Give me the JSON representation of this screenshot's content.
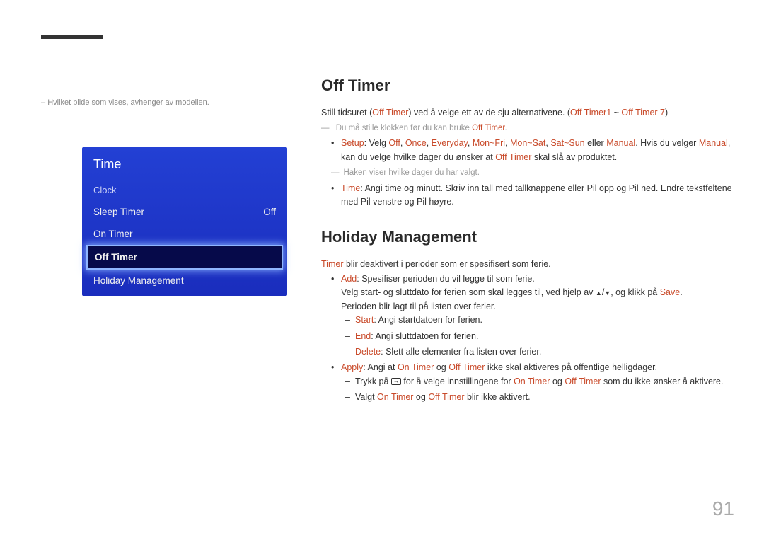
{
  "page_number": "91",
  "sidebar": {
    "title": "Time",
    "items": [
      {
        "label": "Clock",
        "value": ""
      },
      {
        "label": "Sleep Timer",
        "value": "Off"
      },
      {
        "label": "On Timer",
        "value": ""
      },
      {
        "label": "Off Timer",
        "value": ""
      },
      {
        "label": "Holiday Management",
        "value": ""
      }
    ],
    "caption_dash": "–",
    "caption": "Hvilket bilde som vises, avhenger av modellen."
  },
  "sections": {
    "off_timer": {
      "heading": "Off Timer",
      "intro_prefix": "Still tidsuret (",
      "intro_red1": "Off Timer",
      "intro_mid1": ") ved å velge ett av de sju alternativene. (",
      "intro_red2": "Off Timer1",
      "intro_tilde": " ~ ",
      "intro_red3": "Off Timer 7",
      "intro_suffix": ")",
      "note1_a": "Du må stille klokken før du kan bruke ",
      "note1_b": "Off Timer",
      "note1_c": ".",
      "setup_label": "Setup",
      "setup_a": ": Velg ",
      "setup_off": "Off",
      "setup_c1": ", ",
      "setup_once": "Once",
      "setup_c2": ", ",
      "setup_everyday": "Everyday",
      "setup_c3": ", ",
      "setup_monfri": "Mon~Fri",
      "setup_c4": ", ",
      "setup_monsat": "Mon~Sat",
      "setup_c5": ", ",
      "setup_satsun": "Sat~Sun",
      "setup_eller": " eller ",
      "setup_manual": "Manual",
      "setup_b": ". Hvis du velger ",
      "setup_manual2": "Manual",
      "setup_c": ", kan du velge hvilke dager du ønsker at ",
      "setup_offtimer": "Off Timer",
      "setup_d": " skal slå av produktet.",
      "note2": "Haken viser hvilke dager du har valgt.",
      "time_label": "Time",
      "time_text": ": Angi time og minutt. Skriv inn tall med tallknappene eller Pil opp og Pil ned. Endre tekstfeltene med Pil venstre og Pil høyre."
    },
    "holiday": {
      "heading": "Holiday Management",
      "intro_red": "Timer",
      "intro_rest": " blir deaktivert i perioder som er spesifisert som ferie.",
      "add_label": "Add",
      "add_text": ": Spesifiser perioden du vil legge til som ferie.",
      "add_line2a": "Velg start- og sluttdato for ferien som skal legges til, ved hjelp av ",
      "add_line2b": ", og klikk på ",
      "add_save": "Save",
      "add_line2c": ".",
      "add_line3": "Perioden blir lagt til på listen over ferier.",
      "start_label": "Start",
      "start_text": ": Angi startdatoen for ferien.",
      "end_label": "End",
      "end_text": ": Angi sluttdatoen for ferien.",
      "delete_label": "Delete",
      "delete_text": ": Slett alle elementer fra listen over ferier.",
      "apply_label": "Apply",
      "apply_a": ": Angi at ",
      "apply_on": "On Timer",
      "apply_og": " og ",
      "apply_off": "Off Timer",
      "apply_b": " ikke skal aktiveres på offentlige helligdager.",
      "apply_d1a": "Trykk på ",
      "apply_d1b": " for å velge innstillingene for ",
      "apply_d1c": " som du ikke ønsker å aktivere.",
      "apply_d2a": "Valgt ",
      "apply_d2b": " blir ikke aktivert."
    }
  }
}
